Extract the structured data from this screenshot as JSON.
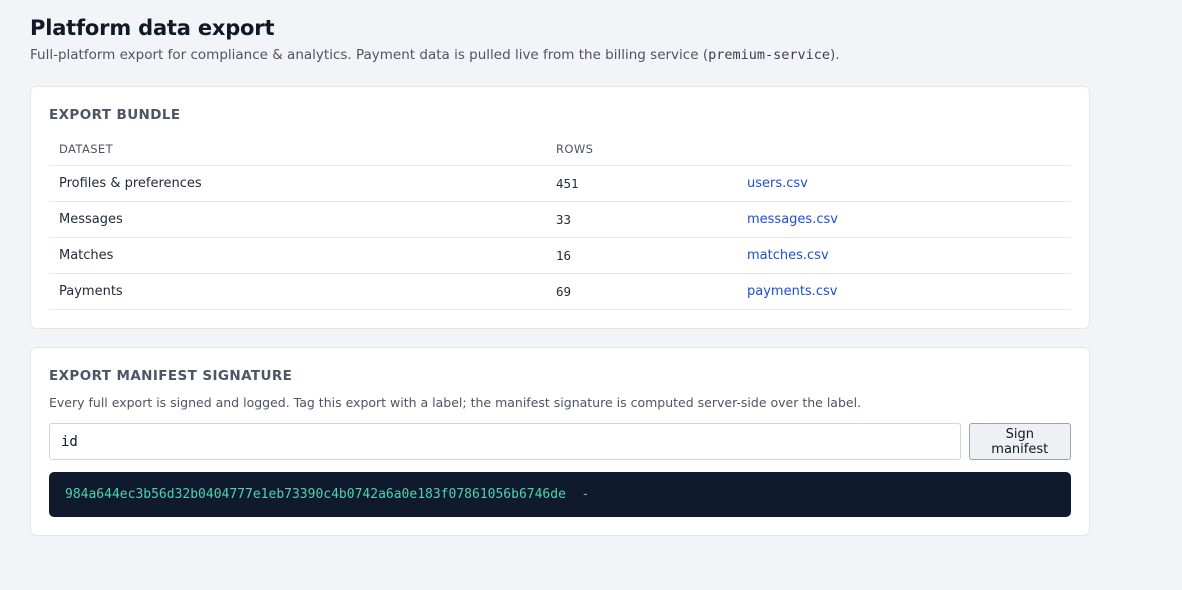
{
  "header": {
    "title": "Platform data export",
    "subtitle_prefix": "Full-platform export for compliance & analytics. Payment data is pulled live from the billing service (",
    "subtitle_code": "premium-service",
    "subtitle_suffix": ")."
  },
  "bundle": {
    "title": "EXPORT BUNDLE",
    "columns": [
      "DATASET",
      "ROWS",
      ""
    ],
    "rows": [
      {
        "dataset": "Profiles & preferences",
        "rows": "451",
        "file": "users.csv"
      },
      {
        "dataset": "Messages",
        "rows": "33",
        "file": "messages.csv"
      },
      {
        "dataset": "Matches",
        "rows": "16",
        "file": "matches.csv"
      },
      {
        "dataset": "Payments",
        "rows": "69",
        "file": "payments.csv"
      }
    ]
  },
  "signature": {
    "title": "EXPORT MANIFEST SIGNATURE",
    "description": "Every full export is signed and logged. Tag this export with a label; the manifest signature is computed server-side over the label.",
    "input_value": "id",
    "button_label": "Sign manifest",
    "output": "984a644ec3b56d32b0404777e1eb73390c4b0742a6a0e183f07861056b6746de  -"
  },
  "colors": {
    "background": "#f3f4f7",
    "link": "#1d4ed8",
    "signature_bg": "#0f1b2d",
    "signature_text": "#4fd1b5"
  }
}
